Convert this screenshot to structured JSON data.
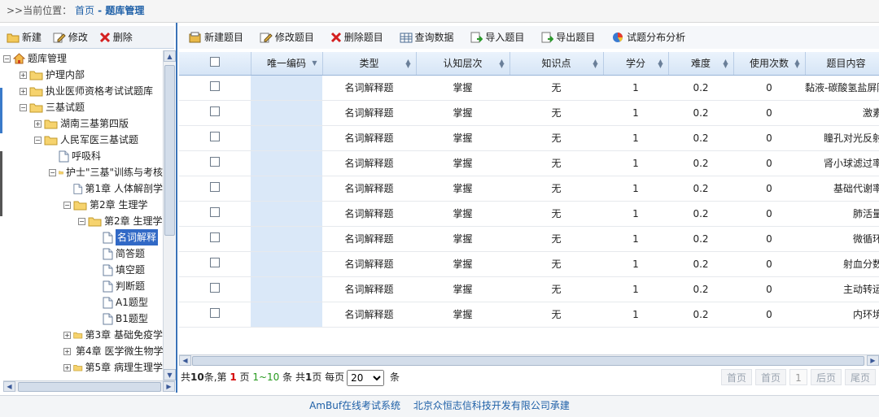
{
  "breadcrumb": {
    "prefix": ">>当前位置：",
    "home": "首页",
    "sep": " - ",
    "current": "题库管理"
  },
  "left_toolbar": {
    "new": "新建",
    "edit": "修改",
    "delete": "删除"
  },
  "tree": [
    {
      "label": "题库管理",
      "level": 0,
      "exp": "-",
      "icon": "home"
    },
    {
      "label": "护理内部",
      "level": 1,
      "exp": "+",
      "icon": "folder"
    },
    {
      "label": "执业医师资格考试试题库",
      "level": 1,
      "exp": "+",
      "icon": "folder"
    },
    {
      "label": "三基试题",
      "level": 1,
      "exp": "-",
      "icon": "folder"
    },
    {
      "label": "湖南三基第四版",
      "level": 2,
      "exp": "+",
      "icon": "folder"
    },
    {
      "label": "人民军医三基试题",
      "level": 2,
      "exp": "-",
      "icon": "folder"
    },
    {
      "label": "呼吸科",
      "level": 3,
      "exp": "",
      "icon": "file"
    },
    {
      "label": "护士\"三基\"训练与考核",
      "level": 3,
      "exp": "-",
      "icon": "folder"
    },
    {
      "label": "第1章 人体解剖学",
      "level": 4,
      "exp": "",
      "icon": "file"
    },
    {
      "label": "第2章 生理学",
      "level": 4,
      "exp": "-",
      "icon": "folder"
    },
    {
      "label": "第2章 生理学",
      "level": 5,
      "exp": "-",
      "icon": "folder"
    },
    {
      "label": "名词解释",
      "level": 6,
      "exp": "",
      "icon": "file",
      "selected": true
    },
    {
      "label": "简答题",
      "level": 6,
      "exp": "",
      "icon": "file"
    },
    {
      "label": "填空题",
      "level": 6,
      "exp": "",
      "icon": "file"
    },
    {
      "label": "判断题",
      "level": 6,
      "exp": "",
      "icon": "file"
    },
    {
      "label": "A1题型",
      "level": 6,
      "exp": "",
      "icon": "file"
    },
    {
      "label": "B1题型",
      "level": 6,
      "exp": "",
      "icon": "file"
    },
    {
      "label": "第3章 基础免疫学",
      "level": 4,
      "exp": "+",
      "icon": "folder"
    },
    {
      "label": "第4章 医学微生物学",
      "level": 4,
      "exp": "+",
      "icon": "folder"
    },
    {
      "label": "第5章 病理生理学",
      "level": 4,
      "exp": "+",
      "icon": "folder"
    }
  ],
  "right_toolbar": {
    "new_question": "新建题目",
    "edit_question": "修改题目",
    "delete_question": "删除题目",
    "query_data": "查询数据",
    "import_question": "导入题目",
    "export_question": "导出题目",
    "analysis": "试题分布分析"
  },
  "table": {
    "headers": [
      "唯一编码",
      "类型",
      "认知层次",
      "知识点",
      "学分",
      "难度",
      "使用次数",
      "题目内容"
    ],
    "rows": [
      [
        "",
        "名词解释题",
        "掌握",
        "无",
        "1",
        "0.2",
        "0",
        "黏液-碳酸氢盐屏障"
      ],
      [
        "",
        "名词解释题",
        "掌握",
        "无",
        "1",
        "0.2",
        "0",
        "激素"
      ],
      [
        "",
        "名词解释题",
        "掌握",
        "无",
        "1",
        "0.2",
        "0",
        "瞳孔对光反射"
      ],
      [
        "",
        "名词解释题",
        "掌握",
        "无",
        "1",
        "0.2",
        "0",
        "肾小球滤过率"
      ],
      [
        "",
        "名词解释题",
        "掌握",
        "无",
        "1",
        "0.2",
        "0",
        "基础代谢率"
      ],
      [
        "",
        "名词解释题",
        "掌握",
        "无",
        "1",
        "0.2",
        "0",
        "肺活量"
      ],
      [
        "",
        "名词解释题",
        "掌握",
        "无",
        "1",
        "0.2",
        "0",
        "微循环"
      ],
      [
        "",
        "名词解释题",
        "掌握",
        "无",
        "1",
        "0.2",
        "0",
        "射血分数"
      ],
      [
        "",
        "名词解释题",
        "掌握",
        "无",
        "1",
        "0.2",
        "0",
        "主动转运"
      ],
      [
        "",
        "名词解释题",
        "掌握",
        "无",
        "1",
        "0.2",
        "0",
        "内环境"
      ]
    ]
  },
  "pager": {
    "t1": "共",
    "total": "10",
    "t2": "条,第 ",
    "page": "1",
    "t3": " 页 ",
    "range": "1~10",
    "t4": " 条 共",
    "pages": "1",
    "t5": "页 每页",
    "page_size": "20",
    "t6": " 条",
    "first": "首页",
    "prev": "首页",
    "current": "1",
    "next": "后页",
    "last": "尾页"
  },
  "footer": {
    "system": "AmBuf在线考试系统",
    "company": "北京众恒志信科技开发有限公司承建"
  },
  "colors": {
    "accent": "#3b73b8",
    "header_bg": "#d6e5f6",
    "id_col": "#dae8f8",
    "selected": "#3169c6"
  }
}
